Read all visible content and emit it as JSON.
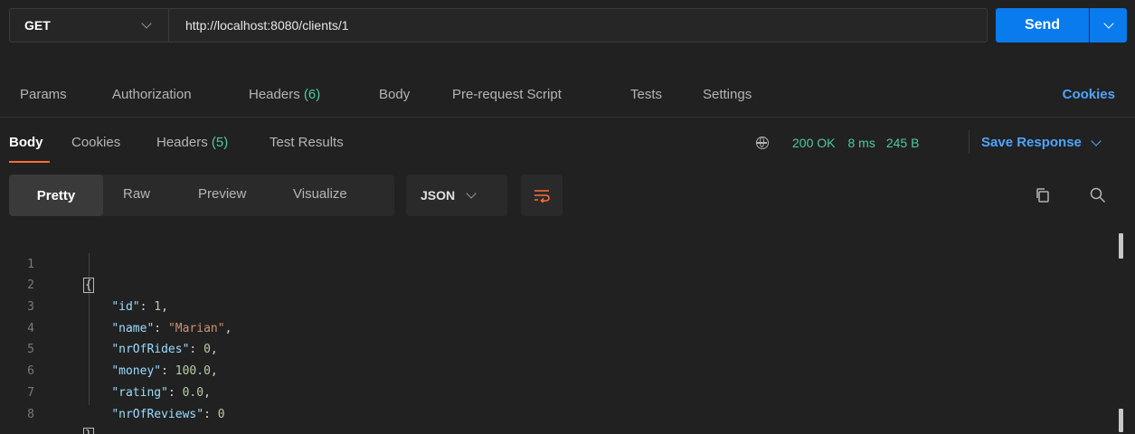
{
  "request": {
    "method": "GET",
    "url": "http://localhost:8080/clients/1",
    "send_label": "Send"
  },
  "request_tabs": [
    {
      "label": "Params"
    },
    {
      "label": "Authorization"
    },
    {
      "label": "Headers",
      "count": "(6)"
    },
    {
      "label": "Body"
    },
    {
      "label": "Pre-request Script"
    },
    {
      "label": "Tests"
    },
    {
      "label": "Settings"
    }
  ],
  "cookies_label": "Cookies",
  "response_tabs": [
    {
      "label": "Body"
    },
    {
      "label": "Cookies"
    },
    {
      "label": "Headers",
      "count": "(5)"
    },
    {
      "label": "Test Results"
    }
  ],
  "status": {
    "code": "200 OK",
    "time": "8 ms",
    "size": "245 B",
    "save_response_label": "Save Response"
  },
  "format": {
    "options": [
      "Pretty",
      "Raw",
      "Preview",
      "Visualize"
    ],
    "selected": "Pretty",
    "language": "JSON"
  },
  "code_lines": [
    {
      "n": "1",
      "open": "{"
    },
    {
      "n": "2",
      "key": "\"id\"",
      "value": "1",
      "type": "num",
      "comma": ","
    },
    {
      "n": "3",
      "key": "\"name\"",
      "value": "\"Marian\"",
      "type": "str",
      "comma": ","
    },
    {
      "n": "4",
      "key": "\"nrOfRides\"",
      "value": "0",
      "type": "num",
      "comma": ","
    },
    {
      "n": "5",
      "key": "\"money\"",
      "value": "100.0",
      "type": "num",
      "comma": ","
    },
    {
      "n": "6",
      "key": "\"rating\"",
      "value": "0.0",
      "type": "num",
      "comma": ","
    },
    {
      "n": "7",
      "key": "\"nrOfReviews\"",
      "value": "0",
      "type": "num",
      "comma": ""
    },
    {
      "n": "8",
      "close": "}"
    }
  ],
  "colors": {
    "accent": "#097bed",
    "tab_underline": "#ff6c37",
    "status_green": "#4ec9a0",
    "link_blue": "#4ea4ff"
  }
}
